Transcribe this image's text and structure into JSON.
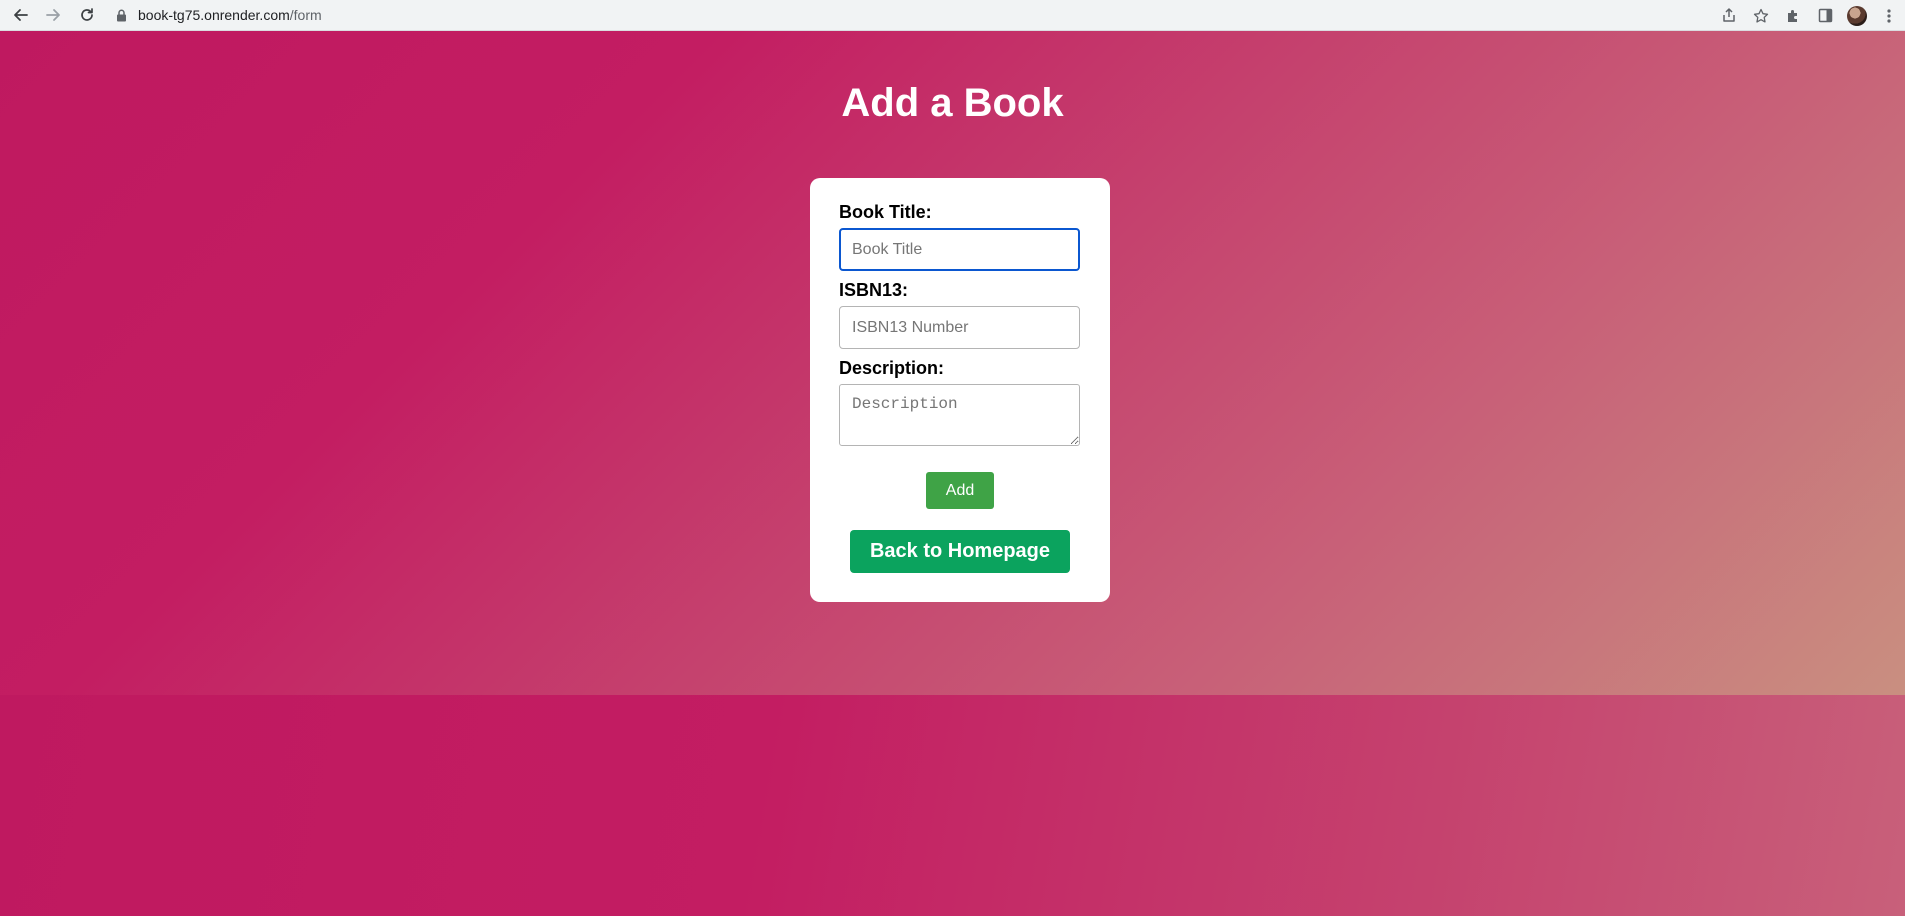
{
  "browser": {
    "url_host": "book-tg75.onrender.com",
    "url_path": "/form",
    "icons": [
      "back-arrow-icon",
      "forward-arrow-icon",
      "reload-icon",
      "lock-icon",
      "share-icon",
      "star-icon",
      "extensions-icon",
      "side-panel-icon",
      "avatar",
      "more-icon"
    ]
  },
  "page": {
    "title": "Add a Book",
    "background_colors": [
      "#bf1960",
      "#c5426e",
      "#c98f80"
    ]
  },
  "form": {
    "title_label": "Book Title:",
    "title_placeholder": "Book Title",
    "title_value": "",
    "isbn_label": "ISBN13:",
    "isbn_placeholder": "ISBN13 Number",
    "isbn_value": "",
    "description_label": "Description:",
    "description_placeholder": "Description",
    "description_value": "",
    "add_label": "Add",
    "add_color": "#3fa346"
  },
  "navigation": {
    "home_label": "Back to Homepage",
    "home_color": "#0ba35e"
  }
}
